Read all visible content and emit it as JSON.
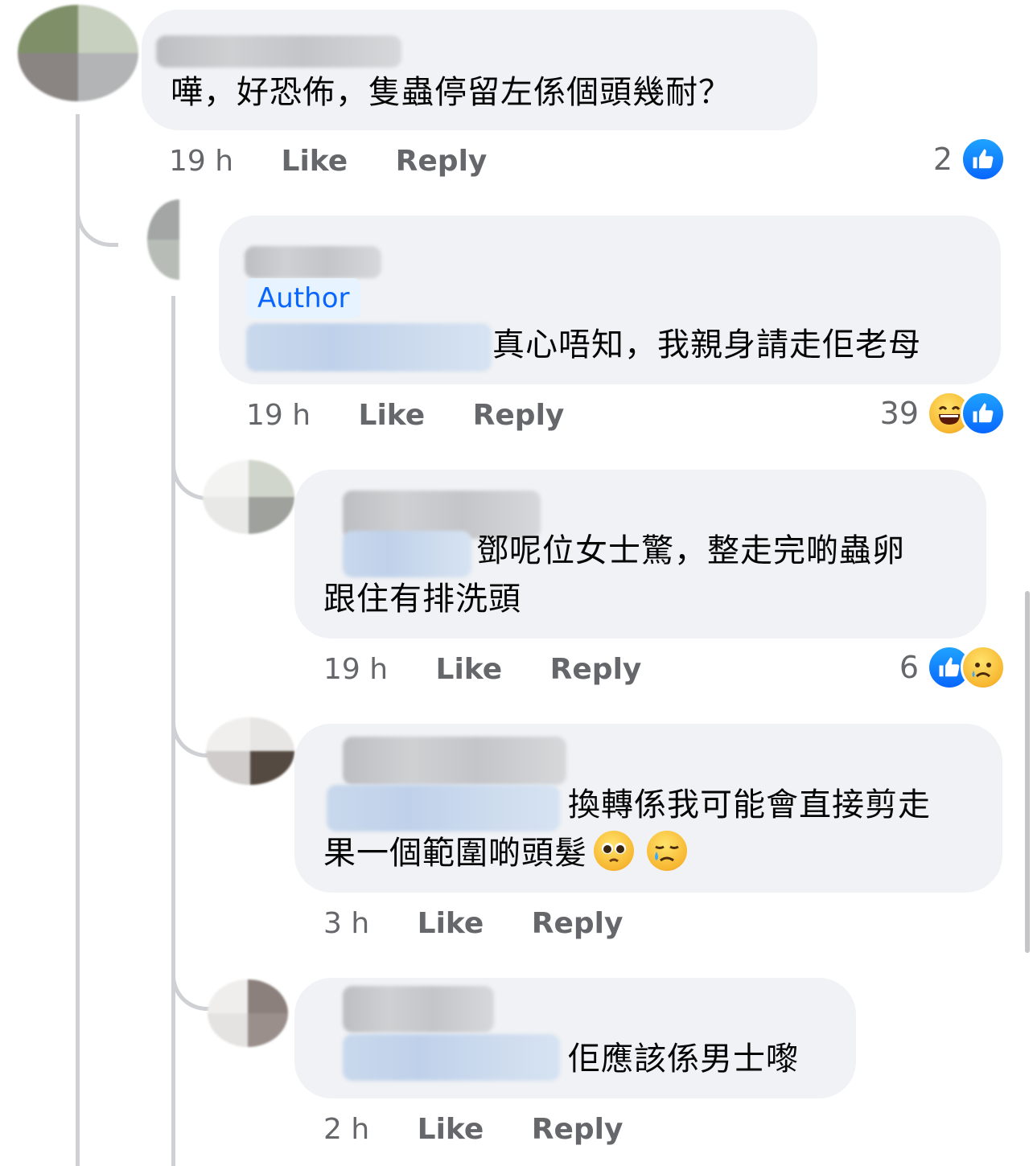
{
  "comments": [
    {
      "text": "嘩，好恐佈，隻蟲停留左係個頭幾耐？",
      "time": "19 h",
      "like_label": "Like",
      "reply_label": "Reply",
      "reaction_count": "2",
      "reactions": [
        "like-icon"
      ]
    },
    {
      "author_badge": "Author",
      "text": "真心唔知，我親身請走佢老母",
      "time": "19 h",
      "like_label": "Like",
      "reply_label": "Reply",
      "reaction_count": "39",
      "reactions": [
        "laughing-emoji-icon",
        "like-icon"
      ]
    },
    {
      "text_line1": "鄧呢位女士驚，整走完啲蟲卵",
      "text_line2": "跟住有排洗頭",
      "time": "19 h",
      "like_label": "Like",
      "reply_label": "Reply",
      "reaction_count": "6",
      "reactions": [
        "like-icon",
        "sad-emoji-icon"
      ]
    },
    {
      "text_line1": "換轉係我可能會直接剪走",
      "text_line2": "果一個範圍啲頭髮",
      "inline_emojis": [
        "pleading-face-icon",
        "crying-face-icon"
      ],
      "time": "3 h",
      "like_label": "Like",
      "reply_label": "Reply"
    },
    {
      "text": "佢應該係男士嚟",
      "time": "2 h",
      "like_label": "Like",
      "reply_label": "Reply"
    }
  ],
  "colors": {
    "bubble": "#f0f2f5",
    "meta_text": "#65676b",
    "like_blue": "#0866ff",
    "thread_line": "#ced0d4"
  }
}
